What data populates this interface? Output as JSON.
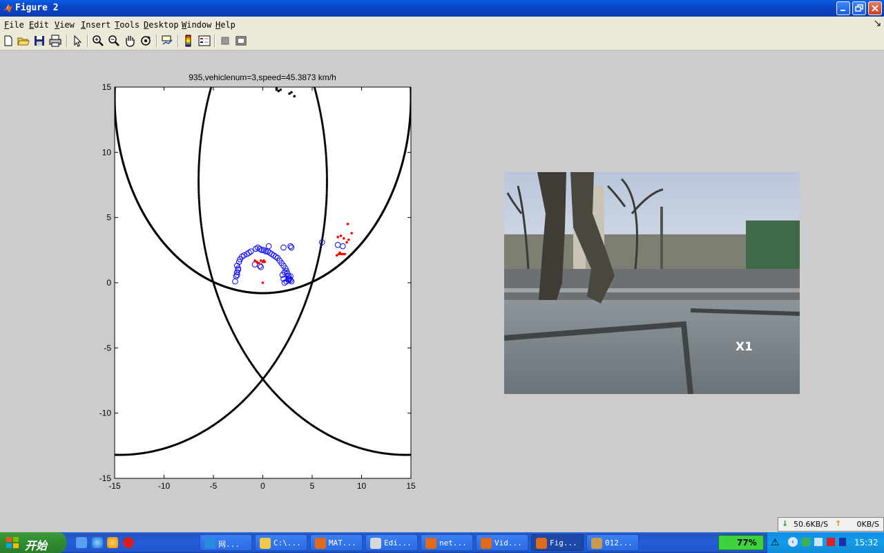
{
  "window": {
    "title": "Figure 2"
  },
  "menu": [
    {
      "label": "File",
      "key": "F"
    },
    {
      "label": "Edit",
      "key": "E"
    },
    {
      "label": "View",
      "key": "V"
    },
    {
      "label": "Insert",
      "key": "I"
    },
    {
      "label": "Tools",
      "key": "T"
    },
    {
      "label": "Desktop",
      "key": "D"
    },
    {
      "label": "Window",
      "key": "W"
    },
    {
      "label": "Help",
      "key": "H"
    }
  ],
  "toolbar": {
    "icons": [
      "new-figure-icon",
      "open-file-icon",
      "save-icon",
      "print-icon",
      "edit-plot-arrow-icon",
      "zoom-in-icon",
      "zoom-out-icon",
      "pan-hand-icon",
      "rotate-3d-icon",
      "data-cursor-icon",
      "colorbar-icon",
      "legend-icon",
      "hide-plot-tools-icon",
      "show-plot-tools-icon"
    ]
  },
  "chart_data": {
    "type": "scatter",
    "title": "935,vehiclenum=3,speed=45.3873 km/h",
    "xlim": [
      -15,
      15
    ],
    "ylim": [
      -15,
      15
    ],
    "xticks": [
      -15,
      -10,
      -5,
      0,
      5,
      10,
      15
    ],
    "yticks": [
      -15,
      -10,
      -5,
      0,
      5,
      10,
      15
    ],
    "grid": false,
    "arcs": [
      {
        "name": "",
        "color": "#000000",
        "center": [
          0,
          14.2
        ],
        "radius": 15.0
      },
      {
        "name": "",
        "color": "#000000",
        "center": [
          -14.5,
          7.8
        ],
        "radius": 21.0
      },
      {
        "name": "",
        "color": "#000000",
        "center": [
          14.5,
          7.8
        ],
        "radius": 21.0
      }
    ],
    "series": [
      {
        "marker": "circle",
        "color": "#0000ff",
        "x": [
          -2.8,
          -2.7,
          -2.6,
          -2.5,
          -2.6,
          -2.4,
          -2.3,
          -2.1,
          -1.9,
          -1.6,
          -1.4,
          -1.2,
          -0.7,
          -0.5,
          -0.3,
          -0.1,
          0.1,
          0.3,
          0.5,
          0.7,
          0.9,
          1.1,
          1.3,
          1.5,
          1.7,
          1.9,
          2.1,
          2.3,
          2.4,
          2.5,
          2.6,
          2.7,
          2.8,
          2.9,
          2.2,
          2.4,
          2.6,
          2.8,
          2.0,
          2.2,
          -0.2,
          -0.3,
          0.6,
          2.1,
          2.9,
          2.8,
          2.1,
          2.6,
          6.0,
          7.6,
          8.1,
          -2.6,
          -2.5,
          -0.8
        ],
        "y": [
          0.1,
          0.5,
          0.8,
          1.1,
          1.3,
          1.6,
          1.8,
          2.0,
          2.1,
          2.2,
          2.3,
          2.4,
          2.6,
          2.7,
          2.6,
          2.5,
          2.5,
          2.4,
          2.4,
          2.3,
          2.2,
          2.1,
          2.0,
          1.9,
          1.7,
          1.5,
          1.3,
          1.1,
          0.9,
          0.7,
          0.5,
          0.3,
          0.2,
          0.1,
          0.0,
          0.1,
          0.3,
          0.5,
          0.6,
          0.8,
          1.2,
          1.3,
          2.8,
          2.7,
          2.7,
          2.8,
          0.3,
          0.2,
          3.1,
          2.9,
          2.8,
          0.6,
          1.0,
          1.4
        ]
      },
      {
        "marker": "dot",
        "color": "#ff0000",
        "x": [
          0.0,
          -0.8,
          -0.6,
          -0.4,
          -0.2,
          0.0,
          0.2,
          -0.5,
          0.1,
          7.5,
          7.7,
          7.9,
          8.1,
          8.3,
          7.6,
          7.9,
          8.2,
          8.5,
          8.6,
          9.0,
          8.7,
          7.8
        ],
        "y": [
          0.0,
          1.7,
          1.6,
          1.5,
          1.7,
          1.6,
          1.6,
          1.5,
          1.7,
          2.1,
          2.2,
          2.2,
          2.2,
          2.2,
          3.5,
          3.6,
          3.4,
          3.1,
          4.5,
          3.8,
          3.3,
          2.3
        ]
      },
      {
        "marker": "dot",
        "color": "#000000",
        "x": [
          1.4,
          1.6,
          1.8,
          2.7,
          2.9,
          3.2,
          1.4
        ],
        "y": [
          14.8,
          14.7,
          14.8,
          14.5,
          14.6,
          14.3,
          14.9
        ]
      }
    ]
  },
  "video": {
    "overlay_text": "X1"
  },
  "taskbar": {
    "start_label": "开始",
    "quicklaunch": [
      "show-desktop-icon",
      "ie-icon",
      "messenger-icon",
      "uu-icon"
    ],
    "tasks": [
      {
        "label": "网...",
        "icon": "ie-icon",
        "active": false
      },
      {
        "label": "C:\\...",
        "icon": "folder-icon",
        "active": false
      },
      {
        "label": "MAT...",
        "icon": "matlab-icon",
        "active": false
      },
      {
        "label": "Edi...",
        "icon": "editor-icon",
        "active": false
      },
      {
        "label": "net...",
        "icon": "matlab-icon",
        "active": false
      },
      {
        "label": "Vid...",
        "icon": "matlab-icon",
        "active": false
      },
      {
        "label": "Fig...",
        "icon": "matlab-icon",
        "active": true
      },
      {
        "label": "012...",
        "icon": "media-icon",
        "active": false
      }
    ],
    "battery_percent": "77%",
    "clock": "15:32"
  },
  "netmon": {
    "down": "50.6KB/S",
    "up": "0KB/S"
  }
}
